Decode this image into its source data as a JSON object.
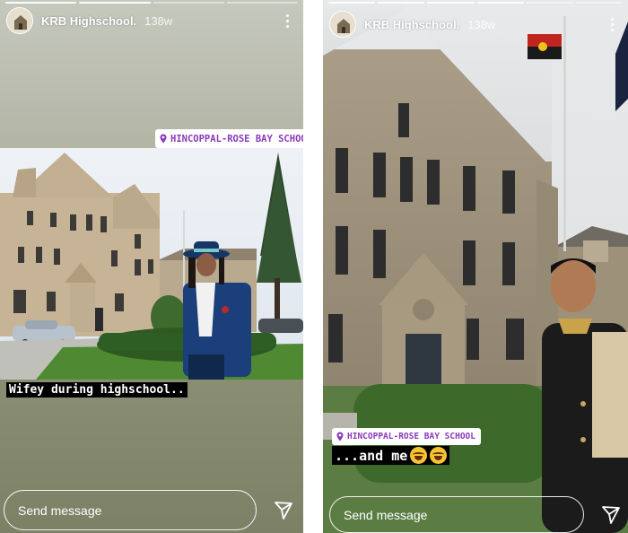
{
  "stories": [
    {
      "username": "KRB Highschool.",
      "time": "138w",
      "location": "HINCOPPAL-ROSE BAY SCHOOL",
      "caption": "Wifey during highschool..",
      "message_placeholder": "Send message",
      "icons": {
        "more": "more-vertical-icon",
        "send": "paper-plane-icon",
        "location": "location-pin-icon"
      }
    },
    {
      "username": "KRB Highschool.",
      "time": "138w",
      "location": "HINCOPPAL-ROSE BAY SCHOOL",
      "caption": "...and me",
      "caption_emoji": [
        "joy-emoji-icon",
        "joy-emoji-icon"
      ],
      "message_placeholder": "Send message",
      "icons": {
        "more": "more-vertical-icon",
        "send": "paper-plane-icon",
        "location": "location-pin-icon"
      }
    }
  ],
  "colors": {
    "location_text": "#8a3ab9",
    "caption_bg": "#000000",
    "caption_text": "#ffffff"
  }
}
